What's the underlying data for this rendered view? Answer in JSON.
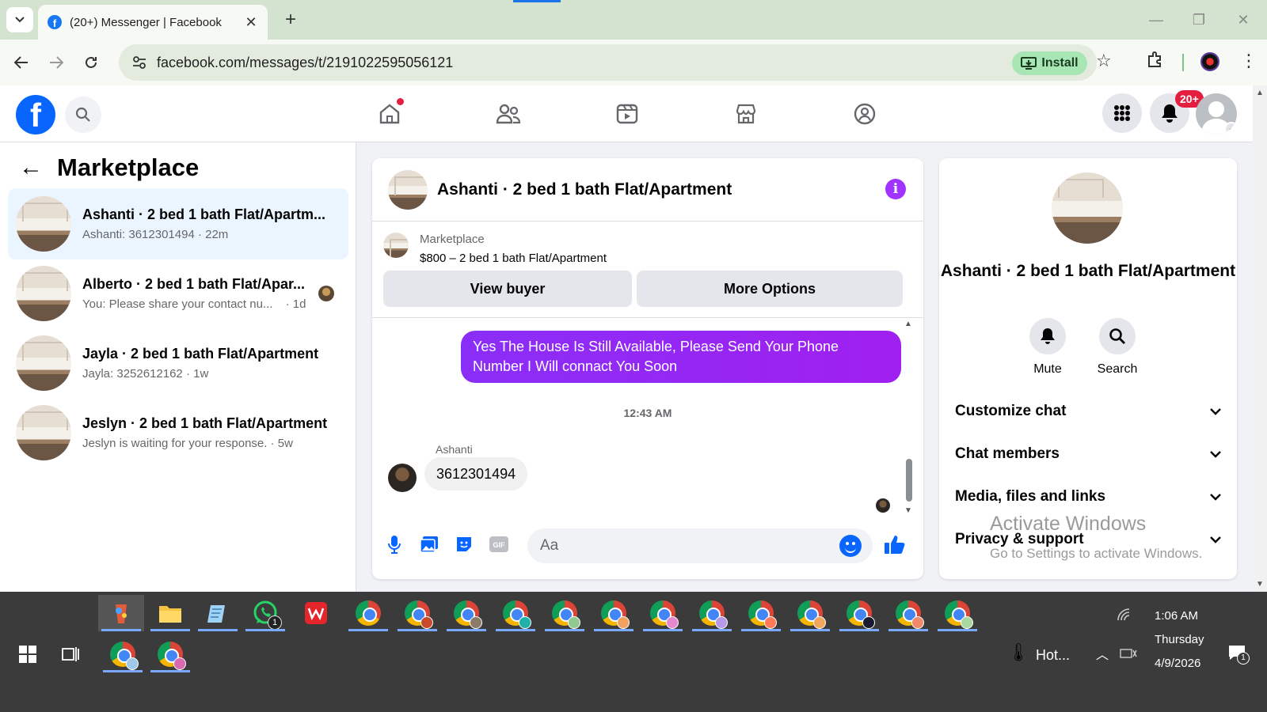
{
  "browser": {
    "tab_title": "(20+) Messenger | Facebook",
    "new_tab_label": "+",
    "url": "facebook.com/messages/t/2191022595056121",
    "install_label": "Install"
  },
  "fb": {
    "notification_badge": "20+"
  },
  "left": {
    "heading": "Marketplace",
    "conversations": [
      {
        "name": "Ashanti · 2 bed 1 bath Flat/Apartm...",
        "preview": "Ashanti: 3612301494 · 22m"
      },
      {
        "name": "Alberto · 2 bed 1 bath Flat/Apar...",
        "preview": "You: Please share your contact nu...",
        "time": "· 1d"
      },
      {
        "name": "Jayla · 2 bed 1 bath Flat/Apartment",
        "preview": "Jayla: 3252612162 · 1w"
      },
      {
        "name": "Jeslyn · 2 bed 1 bath Flat/Apartment",
        "preview": "Jeslyn is waiting for your response. · 5w"
      }
    ]
  },
  "chat": {
    "title": "Ashanti · 2 bed 1 bath Flat/Apartment",
    "marketplace_label": "Marketplace",
    "listing": "$800 – 2 bed 1 bath Flat/Apartment",
    "view_buyer": "View buyer",
    "more_options": "More Options",
    "outgoing_message": "Yes The House Is Still Available, Please Send Your Phone Number I Will connact You Soon",
    "timestamp": "12:43 AM",
    "sender_name": "Ashanti",
    "incoming_message": "3612301494",
    "composer_placeholder": "Aa"
  },
  "info": {
    "title": "Ashanti · 2 bed 1 bath Flat/Apartment",
    "mute_label": "Mute",
    "search_label": "Search",
    "rows": [
      "Customize chat",
      "Chat members",
      "Media, files and links",
      "Privacy & support"
    ]
  },
  "watermark": {
    "line1": "Activate Windows",
    "line2": "Go to Settings to activate Windows."
  },
  "taskbar": {
    "whatsapp_badge": "1",
    "weather": "Hot...",
    "time": "1:06 AM",
    "day": "Thursday",
    "date": "4/9/2026",
    "notif_badge": "1"
  },
  "colors": {
    "fb_blue": "#0866ff",
    "message_purple": "#a020f0",
    "active_conversation": "#ebf5ff",
    "taskbar": "#3b3b3b"
  }
}
